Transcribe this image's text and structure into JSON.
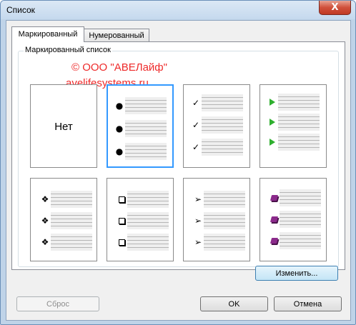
{
  "window": {
    "title": "Список",
    "close_label": "X"
  },
  "tabs": [
    {
      "label": "Маркированный"
    },
    {
      "label": "Нумерованный"
    }
  ],
  "group": {
    "label": "Маркированный список"
  },
  "watermark": {
    "line1": "© ООО \"АВЕЛайф\"",
    "line2": "avelifesystems.ru"
  },
  "gallery": {
    "none_label": "Нет",
    "selected_index": 1,
    "styles": [
      "none",
      "bullet-dot",
      "checkmark",
      "green-triangle",
      "four-diamond",
      "hollow-square",
      "arrowhead",
      "book"
    ]
  },
  "buttons": {
    "change": "Изменить...",
    "reset": "Сброс",
    "ok": "OK",
    "cancel": "Отмена"
  }
}
